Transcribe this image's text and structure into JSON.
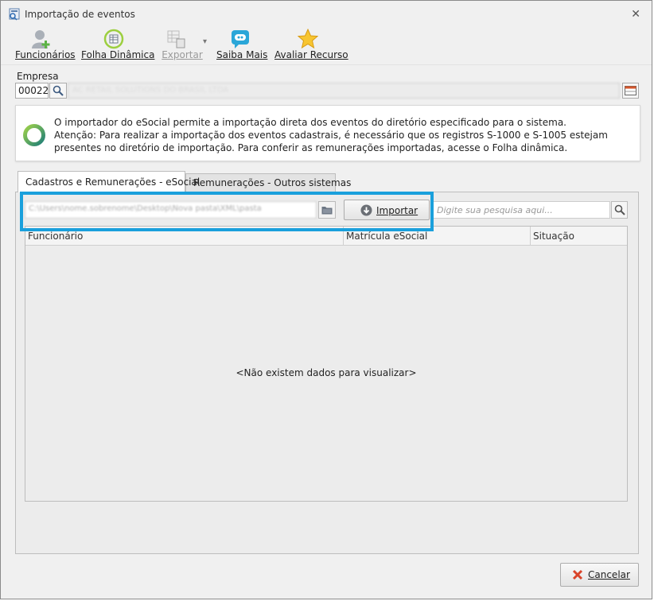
{
  "window": {
    "title": "Importação de eventos",
    "close_glyph": "✕"
  },
  "toolbar": {
    "items": [
      {
        "label": "Funcionários",
        "icon": "add-user-icon",
        "enabled": true
      },
      {
        "label": "Folha Dinâmica",
        "icon": "spreadsheet-refresh-icon",
        "enabled": true
      },
      {
        "label": "Exportar",
        "icon": "export-table-icon",
        "enabled": false
      },
      {
        "label": "Saiba Mais",
        "icon": "info-chat-icon",
        "enabled": true
      },
      {
        "label": "Avaliar Recurso",
        "icon": "star-icon",
        "enabled": true
      }
    ],
    "dropdown_glyph": "▾"
  },
  "empresa": {
    "label": "Empresa",
    "code": "00022",
    "name": "AC RETAIL SOLUTIONS DO BRASIL LTDA"
  },
  "info": {
    "line1": "O importador do eSocial permite a importação direta dos eventos do diretório especificado para o sistema.",
    "line2": "Atenção: Para realizar a importação dos eventos cadastrais, é necessário que os registros S-1000 e S-1005 estejam presentes no diretório de importação. Para conferir as remunerações importadas, acesse o Folha dinâmica."
  },
  "tabs": [
    {
      "label": "Cadastros e Remunerações - eSocial",
      "active": true
    },
    {
      "label": "Remunerações - Outros sistemas",
      "active": false
    }
  ],
  "import": {
    "path_value": "C:\\Users\\nome.sobrenome\\Desktop\\Nova pasta\\XML\\pasta",
    "button_label": "Importar",
    "search_placeholder": "Digite sua pesquisa aqui..."
  },
  "grid": {
    "columns": [
      "Funcionário",
      "Matrícula eSocial",
      "Situação"
    ],
    "empty_message": "<Não existem dados para visualizar>"
  },
  "footer": {
    "cancel_label": "Cancelar"
  },
  "colors": {
    "highlight": "#1aa0dc",
    "accent_green": "#2f9e6e",
    "cancel_red": "#d9442a"
  }
}
